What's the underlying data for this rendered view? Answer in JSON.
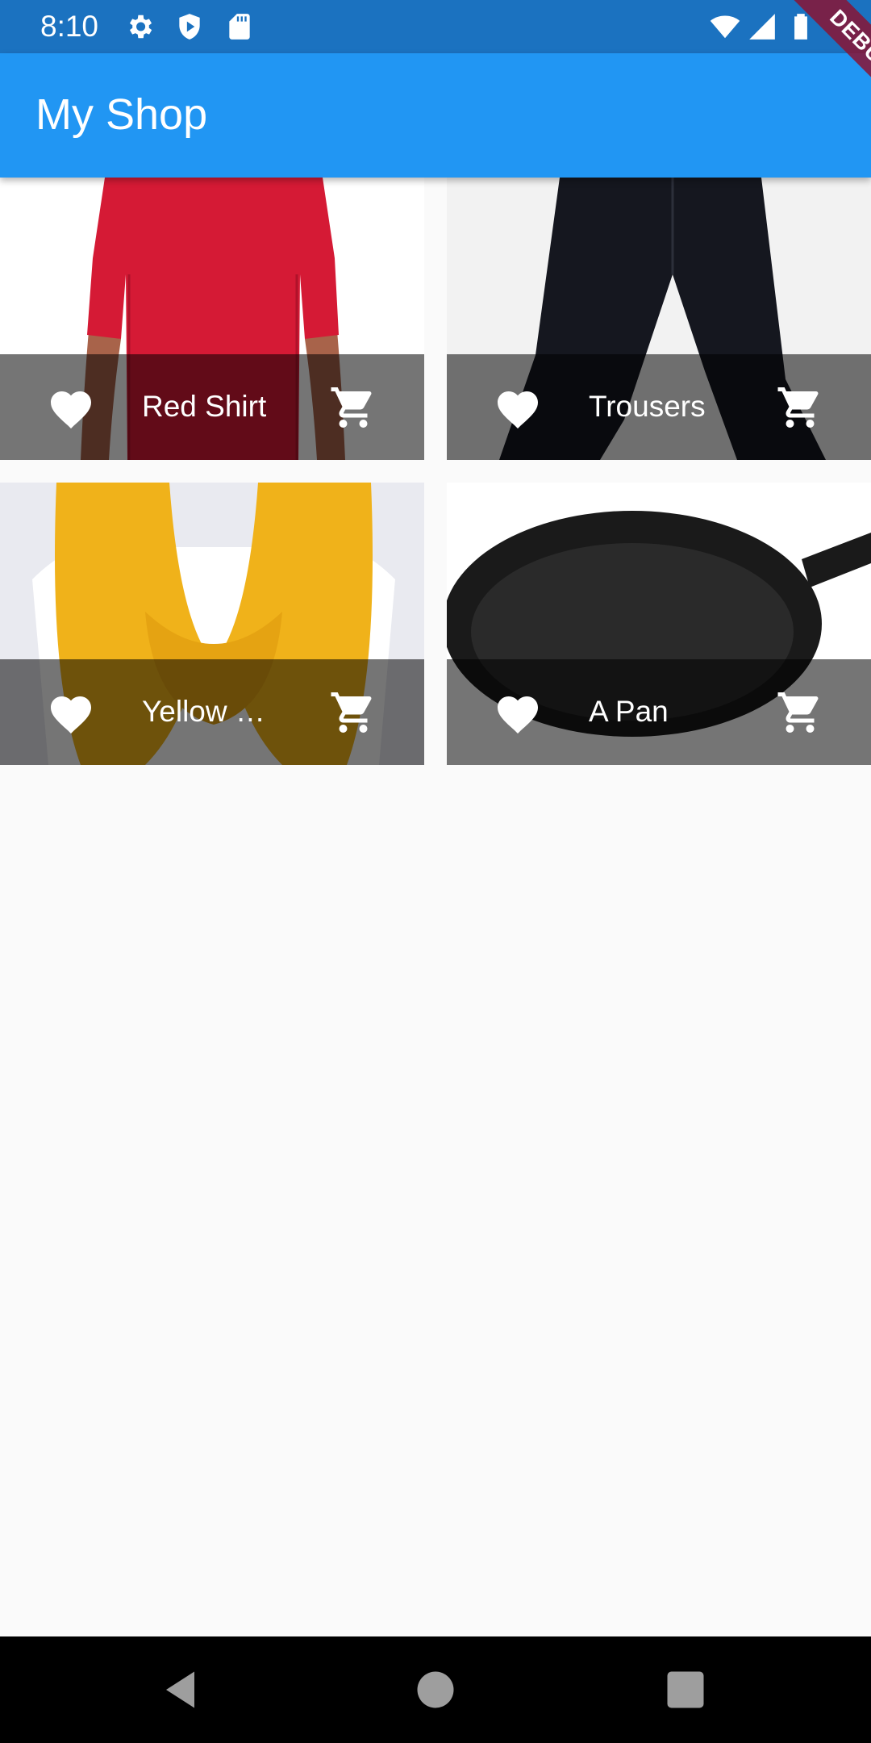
{
  "status_bar": {
    "time": "8:10",
    "left_icons": [
      "settings-icon",
      "play-protect-icon",
      "sd-card-icon"
    ],
    "right_icons": [
      "wifi-icon",
      "signal-icon",
      "battery-icon"
    ]
  },
  "debug_banner": {
    "label": "DEBUG"
  },
  "app_bar": {
    "title": "My Shop",
    "color": "#2196f3"
  },
  "products": [
    {
      "title": "Red Shirt",
      "image": "red-shirt"
    },
    {
      "title": "Trousers",
      "image": "trousers"
    },
    {
      "title": "Yellow Scarf",
      "image": "yellow-scarf"
    },
    {
      "title": "A Pan",
      "image": "pan"
    }
  ],
  "nav_bar": {
    "buttons": [
      "back-icon",
      "home-icon",
      "recents-icon"
    ]
  }
}
